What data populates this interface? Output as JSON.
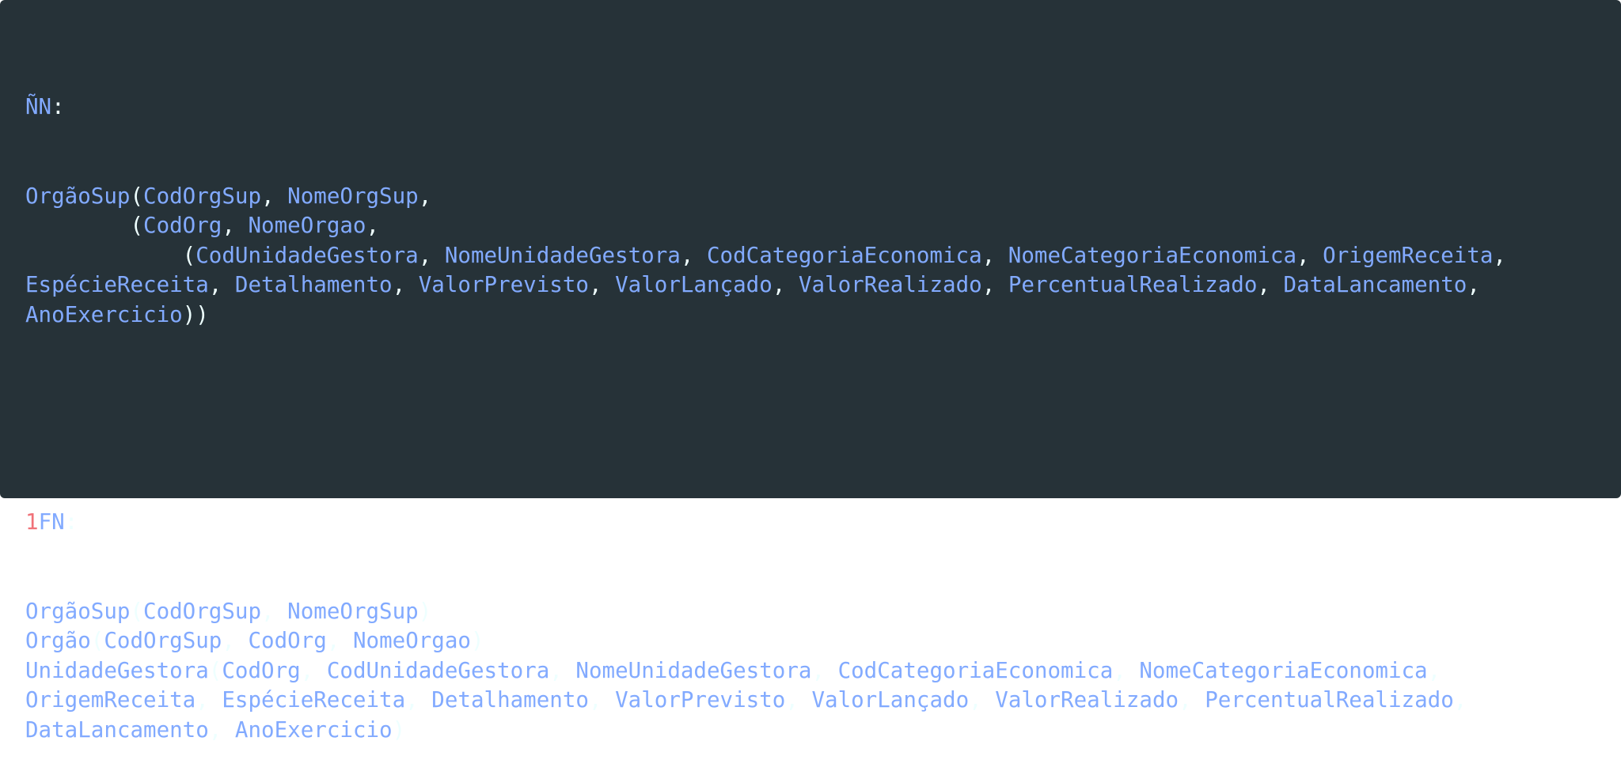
{
  "sections": [
    {
      "heading": {
        "num": "",
        "label": "ÑN",
        "colon": ":"
      },
      "lines": [
        [
          {
            "t": "OrgãoSup",
            "k": "id"
          },
          {
            "t": "(",
            "k": "p"
          },
          {
            "t": "CodOrgSup",
            "k": "id"
          },
          {
            "t": ", ",
            "k": "p"
          },
          {
            "t": "NomeOrgSup",
            "k": "id"
          },
          {
            "t": ",",
            "k": "p"
          }
        ],
        [
          {
            "t": "        (",
            "k": "p"
          },
          {
            "t": "CodOrg",
            "k": "id"
          },
          {
            "t": ", ",
            "k": "p"
          },
          {
            "t": "NomeOrgao",
            "k": "id"
          },
          {
            "t": ",",
            "k": "p"
          }
        ],
        [
          {
            "t": "            (",
            "k": "p"
          },
          {
            "t": "CodUnidadeGestora",
            "k": "id"
          },
          {
            "t": ", ",
            "k": "p"
          },
          {
            "t": "NomeUnidadeGestora",
            "k": "id"
          },
          {
            "t": ", ",
            "k": "p"
          },
          {
            "t": "CodCategoriaEconomica",
            "k": "id"
          },
          {
            "t": ", ",
            "k": "p"
          },
          {
            "t": "NomeCategoriaEconomica",
            "k": "id"
          },
          {
            "t": ", ",
            "k": "p"
          },
          {
            "t": "OrigemReceita",
            "k": "id"
          },
          {
            "t": ",",
            "k": "p"
          }
        ],
        [
          {
            "t": "EspécieReceita",
            "k": "id"
          },
          {
            "t": ", ",
            "k": "p"
          },
          {
            "t": "Detalhamento",
            "k": "id"
          },
          {
            "t": ", ",
            "k": "p"
          },
          {
            "t": "ValorPrevisto",
            "k": "id"
          },
          {
            "t": ", ",
            "k": "p"
          },
          {
            "t": "ValorLançado",
            "k": "id"
          },
          {
            "t": ", ",
            "k": "p"
          },
          {
            "t": "ValorRealizado",
            "k": "id"
          },
          {
            "t": ", ",
            "k": "p"
          },
          {
            "t": "PercentualRealizado",
            "k": "id"
          },
          {
            "t": ", ",
            "k": "p"
          },
          {
            "t": "DataLancamento",
            "k": "id"
          },
          {
            "t": ",",
            "k": "p"
          }
        ],
        [
          {
            "t": "AnoExercicio",
            "k": "id"
          },
          {
            "t": "))",
            "k": "p"
          }
        ]
      ]
    },
    {
      "heading": {
        "num": "1",
        "label": "FN",
        "colon": ":"
      },
      "lines": [
        [
          {
            "t": "OrgãoSup",
            "k": "id"
          },
          {
            "t": "(",
            "k": "p"
          },
          {
            "t": "CodOrgSup",
            "k": "id"
          },
          {
            "t": ", ",
            "k": "p"
          },
          {
            "t": "NomeOrgSup",
            "k": "id"
          },
          {
            "t": ")",
            "k": "p"
          }
        ],
        [
          {
            "t": "Orgão",
            "k": "id"
          },
          {
            "t": "(",
            "k": "p"
          },
          {
            "t": "CodOrgSup",
            "k": "id"
          },
          {
            "t": ", ",
            "k": "p"
          },
          {
            "t": "CodOrg",
            "k": "id"
          },
          {
            "t": ", ",
            "k": "p"
          },
          {
            "t": "NomeOrgao",
            "k": "id"
          },
          {
            "t": ")",
            "k": "p"
          }
        ],
        [
          {
            "t": "UnidadeGestora",
            "k": "id"
          },
          {
            "t": "(",
            "k": "p"
          },
          {
            "t": "CodOrg",
            "k": "id"
          },
          {
            "t": ", ",
            "k": "p"
          },
          {
            "t": "CodUnidadeGestora",
            "k": "id"
          },
          {
            "t": ", ",
            "k": "p"
          },
          {
            "t": "NomeUnidadeGestora",
            "k": "id"
          },
          {
            "t": ", ",
            "k": "p"
          },
          {
            "t": "CodCategoriaEconomica",
            "k": "id"
          },
          {
            "t": ", ",
            "k": "p"
          },
          {
            "t": "NomeCategoriaEconomica",
            "k": "id"
          },
          {
            "t": ",",
            "k": "p"
          }
        ],
        [
          {
            "t": "OrigemReceita",
            "k": "id"
          },
          {
            "t": ", ",
            "k": "p"
          },
          {
            "t": "EspécieReceita",
            "k": "id"
          },
          {
            "t": ", ",
            "k": "p"
          },
          {
            "t": "Detalhamento",
            "k": "id"
          },
          {
            "t": ", ",
            "k": "p"
          },
          {
            "t": "ValorPrevisto",
            "k": "id"
          },
          {
            "t": ", ",
            "k": "p"
          },
          {
            "t": "ValorLançado",
            "k": "id"
          },
          {
            "t": ", ",
            "k": "p"
          },
          {
            "t": "ValorRealizado",
            "k": "id"
          },
          {
            "t": ", ",
            "k": "p"
          },
          {
            "t": "PercentualRealizado",
            "k": "id"
          },
          {
            "t": ",",
            "k": "p"
          }
        ],
        [
          {
            "t": "DataLancamento",
            "k": "id"
          },
          {
            "t": ", ",
            "k": "p"
          },
          {
            "t": "AnoExercicio",
            "k": "id"
          },
          {
            "t": ")",
            "k": "p"
          }
        ]
      ]
    }
  ],
  "colors": {
    "background": "#263238",
    "identifier": "#82aaff",
    "number": "#f07178",
    "punctuation": "#eeffff"
  }
}
